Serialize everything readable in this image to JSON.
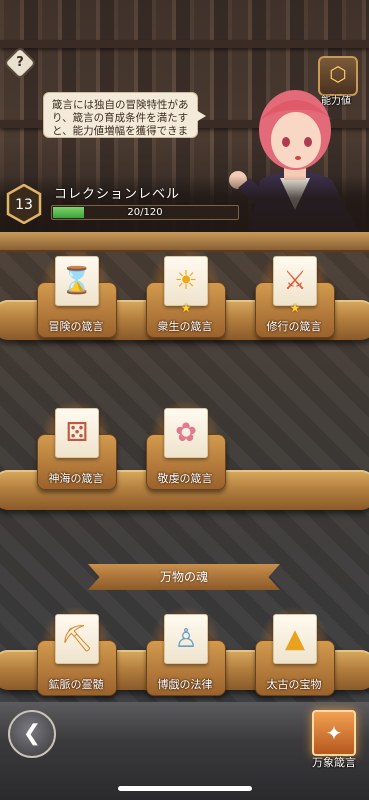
{
  "ability": {
    "label": "能力値",
    "icon": "ability-emblem-icon"
  },
  "help": {
    "label": "?"
  },
  "bubble": {
    "text": "箴言には独自の冒険特性があり、箴言の育成条件を満たすと、能力値増幅を獲得できます"
  },
  "collection": {
    "title": "コレクションレベル",
    "level": "13",
    "progress_text": "20/120",
    "progress_fraction": 0.1667
  },
  "rows": [
    [
      {
        "label": "冒険の箴言",
        "icon": "hourglass-icon",
        "glyph": "⌛",
        "star": false
      },
      {
        "label": "衆生の箴言",
        "icon": "sun-icon",
        "glyph": "☀",
        "star": true
      },
      {
        "label": "修行の箴言",
        "icon": "crossed-swords-icon",
        "glyph": "⚔",
        "star": true
      }
    ],
    [
      {
        "label": "神海の箴言",
        "icon": "dice-icon",
        "glyph": "⚄",
        "star": false
      },
      {
        "label": "敬虔の箴言",
        "icon": "angel-icon",
        "glyph": "✿",
        "star": false
      }
    ]
  ],
  "section": {
    "title": "万物の魂",
    "items": [
      {
        "label": "鉱脈の霊髄",
        "icon": "pickaxe-icon",
        "glyph": "⛏"
      },
      {
        "label": "博戯の法律",
        "icon": "bell-icon",
        "glyph": "♙"
      },
      {
        "label": "太古の宝物",
        "icon": "pyramid-icon",
        "glyph": "▲"
      }
    ]
  },
  "bottom": {
    "back_icon": "back-arrow-icon",
    "banshou_label": "万象箴言",
    "banshou_glyph": "✦"
  },
  "colors": {
    "progress": "#3aa43a",
    "star": "#ffd23c",
    "accent": "#c99a55"
  }
}
